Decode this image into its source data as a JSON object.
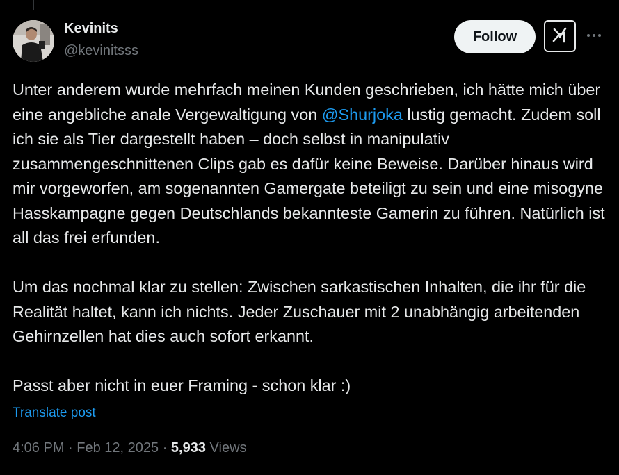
{
  "author": {
    "name": "Kevinits",
    "handle": "@kevinitsss"
  },
  "actions": {
    "follow_label": "Follow"
  },
  "tweet": {
    "paragraph_1_before": "Unter anderem wurde mehrfach meinen Kunden geschrieben, ich hätte mich über eine angebliche anale Vergewaltigung von ",
    "mention": "@Shurjoka",
    "paragraph_1_after": " lustig gemacht. Zudem soll ich sie als Tier dargestellt haben – doch selbst in manipulativ zusammengeschnittenen Clips gab es dafür keine Beweise. Darüber hinaus wird mir vorgeworfen, am sogenannten Gamergate beteiligt zu sein und eine misogyne Hasskampagne gegen Deutschlands bekannteste Gamerin zu führen. Natürlich ist all das frei erfunden.",
    "paragraph_2": "Um das nochmal klar zu stellen: Zwischen sarkastischen Inhalten, die ihr für die Realität haltet, kann ich nichts. Jeder Zuschauer mit 2 unabhängig arbeitenden Gehirnzellen hat dies auch sofort erkannt.",
    "paragraph_3": "Passt aber nicht in euer Framing - schon klar :)",
    "translate_label": "Translate post"
  },
  "meta": {
    "time": "4:06 PM",
    "separator_1": " · ",
    "date": "Feb 12, 2025",
    "separator_2": " · ",
    "views_count": "5,933",
    "views_label": " Views"
  },
  "icons": {
    "grok": "grok-icon",
    "more": "more-icon",
    "avatar": "avatar"
  },
  "colors": {
    "background": "#000000",
    "text": "#e7e9ea",
    "secondary": "#71767b",
    "link": "#1d9bf0",
    "follow_bg": "#eff3f4"
  }
}
